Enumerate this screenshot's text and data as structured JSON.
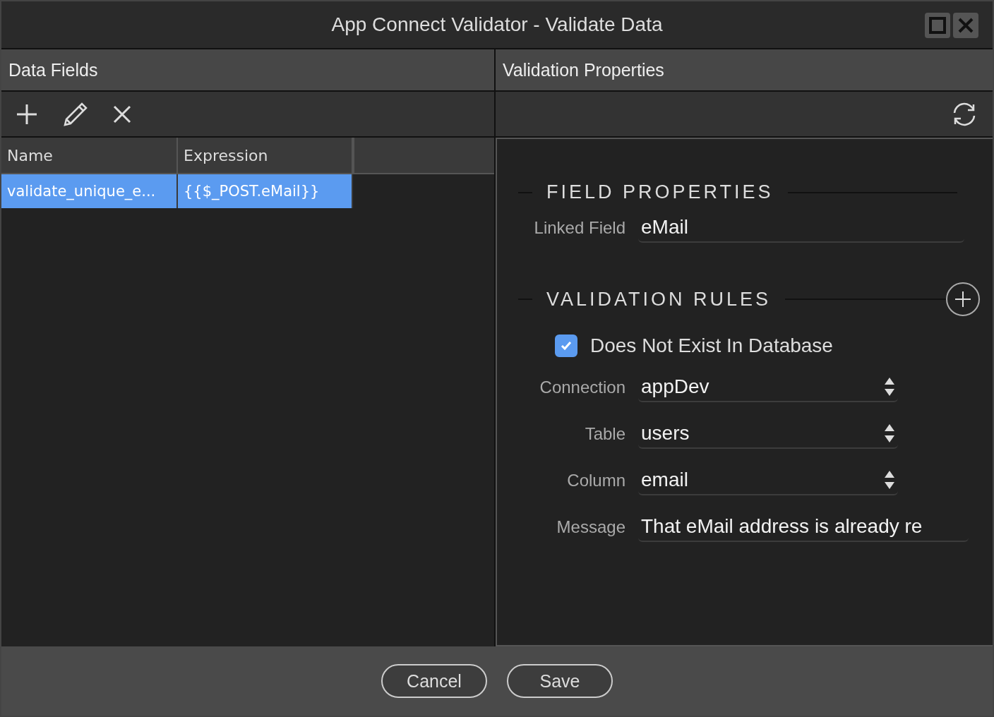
{
  "window": {
    "title": "App Connect Validator - Validate Data"
  },
  "data_fields": {
    "title": "Data Fields",
    "table": {
      "columns": [
        "Name",
        "Expression"
      ],
      "rows": [
        {
          "name": "validate_unique_e...",
          "expression": "{{$_POST.eMail}}",
          "selected": true
        }
      ]
    }
  },
  "validation_properties": {
    "title": "Validation Properties",
    "field_properties": {
      "title": "FIELD PROPERTIES",
      "linked_field": {
        "label": "Linked Field",
        "value": "eMail"
      }
    },
    "validation_rules": {
      "title": "VALIDATION RULES",
      "rule": {
        "label": "Does Not Exist In Database",
        "checked": true
      },
      "fields": [
        {
          "kind": "select",
          "label": "Connection",
          "value": "appDev"
        },
        {
          "kind": "select",
          "label": "Table",
          "value": "users"
        },
        {
          "kind": "select",
          "label": "Column",
          "value": "email"
        },
        {
          "kind": "text",
          "label": "Message",
          "value": "That eMail address is already re"
        }
      ]
    }
  },
  "buttons": [
    "Cancel",
    "Save"
  ]
}
